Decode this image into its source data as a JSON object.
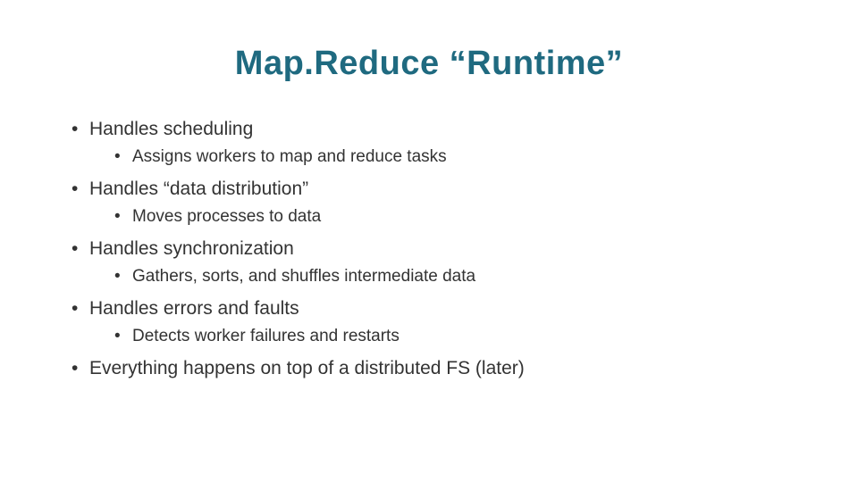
{
  "title": "Map.Reduce  “Runtime”",
  "bullets": [
    {
      "text": "Handles scheduling",
      "sub": [
        "Assigns workers to map and reduce tasks"
      ]
    },
    {
      "text": "Handles “data distribution”",
      "sub": [
        "Moves processes to data"
      ]
    },
    {
      "text": "Handles synchronization",
      "sub": [
        "Gathers, sorts, and shuffles intermediate data"
      ]
    },
    {
      "text": "Handles errors and faults",
      "sub": [
        "Detects worker failures and restarts"
      ]
    },
    {
      "text": "Everything happens on top of a distributed FS (later)",
      "sub": []
    }
  ]
}
